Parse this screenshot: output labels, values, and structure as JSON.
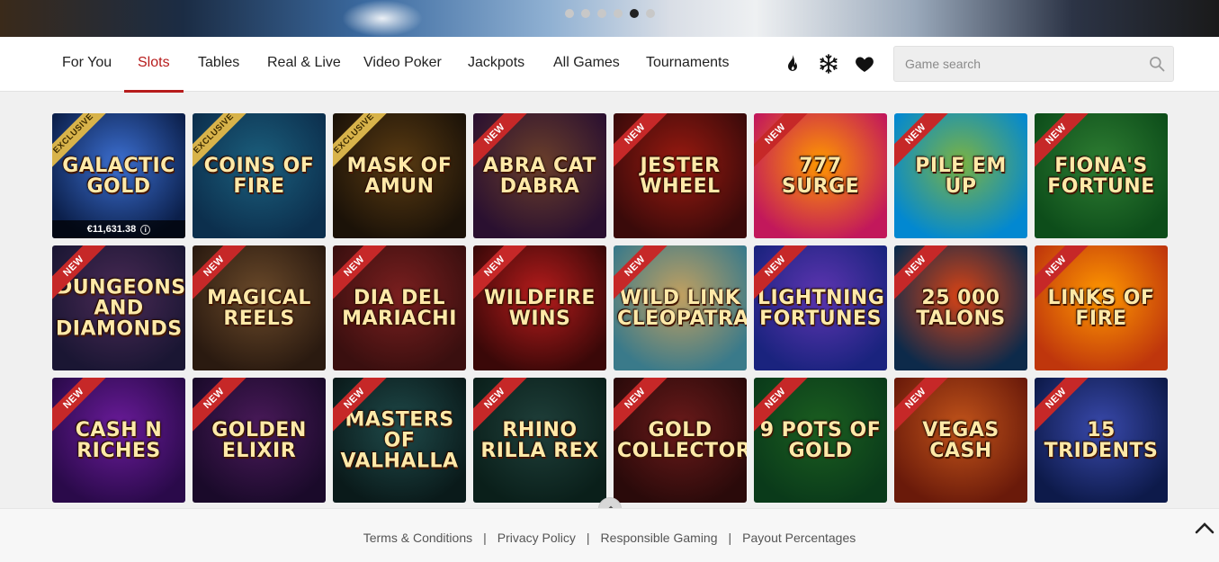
{
  "hero": {
    "slide_count": 6,
    "active_index": 4
  },
  "nav": {
    "tabs": [
      {
        "label": "For You",
        "active": false
      },
      {
        "label": "Slots",
        "active": true
      },
      {
        "label": "Tables",
        "active": false
      },
      {
        "label": "Real & Live",
        "active": false
      },
      {
        "label": "Video Poker",
        "active": false
      },
      {
        "label": "Jackpots",
        "active": false
      },
      {
        "label": "All Games",
        "active": false
      },
      {
        "label": "Tournaments",
        "active": false
      }
    ],
    "icons": [
      "fire-icon",
      "snowflake-icon",
      "heart-icon"
    ],
    "search_placeholder": "Game search"
  },
  "games": [
    {
      "title": "GALACTIC GOLD",
      "badge": "EXCLUSIVE",
      "jackpot": "€11,631.38",
      "colors": [
        "#0b1f4a",
        "#3c6fd1"
      ]
    },
    {
      "title": "COINS OF FIRE",
      "badge": "EXCLUSIVE",
      "colors": [
        "#0c2f4d",
        "#1b5f7d"
      ]
    },
    {
      "title": "MASK OF AMUN",
      "badge": "EXCLUSIVE",
      "colors": [
        "#1b1208",
        "#5a3b12"
      ]
    },
    {
      "title": "ABRA CAT DABRA",
      "badge": "NEW",
      "colors": [
        "#2a1030",
        "#6b3f2a"
      ]
    },
    {
      "title": "JESTER WHEEL",
      "badge": "NEW",
      "colors": [
        "#3a0a0a",
        "#9a1a10"
      ]
    },
    {
      "title": "777 SURGE",
      "badge": "NEW",
      "colors": [
        "#c2185b",
        "#ff9800"
      ]
    },
    {
      "title": "PILE EM UP",
      "badge": "NEW",
      "colors": [
        "#0288d1",
        "#7cb342"
      ]
    },
    {
      "title": "FIONA'S FORTUNE",
      "badge": "NEW",
      "colors": [
        "#0d4d1a",
        "#2e7d32"
      ]
    },
    {
      "title": "DUNGEONS AND DIAMONDS",
      "badge": "NEW",
      "colors": [
        "#1a1633",
        "#4a2a55"
      ]
    },
    {
      "title": "MAGICAL REELS",
      "badge": "NEW",
      "colors": [
        "#2a1a10",
        "#6b4a2a"
      ]
    },
    {
      "title": "DIA DEL MARIACHI",
      "badge": "NEW",
      "colors": [
        "#3a0f0f",
        "#7a1f1f"
      ]
    },
    {
      "title": "WILDFIRE WINS",
      "badge": "NEW",
      "colors": [
        "#3a0808",
        "#b71c1c"
      ]
    },
    {
      "title": "WILD LINK CLEOPATRA",
      "badge": "NEW",
      "colors": [
        "#3a7a8a",
        "#c2a060"
      ]
    },
    {
      "title": "LIGHTNING FORTUNES",
      "badge": "NEW",
      "colors": [
        "#1a237e",
        "#5e35b1"
      ]
    },
    {
      "title": "25 000 TALONS",
      "badge": "NEW",
      "colors": [
        "#0d2a4a",
        "#d84315"
      ]
    },
    {
      "title": "LINKS OF FIRE",
      "badge": "NEW",
      "colors": [
        "#bf360c",
        "#ff9800"
      ]
    },
    {
      "title": "CASH N RICHES",
      "badge": "NEW",
      "colors": [
        "#2a0a4a",
        "#6a1b9a"
      ]
    },
    {
      "title": "GOLDEN ELIXIR",
      "badge": "NEW",
      "colors": [
        "#1a0a2a",
        "#4a1a5a"
      ]
    },
    {
      "title": "MASTERS OF VALHALLA",
      "badge": "NEW",
      "colors": [
        "#0a1a1a",
        "#1f4a4a"
      ]
    },
    {
      "title": "RHINO RILLA REX",
      "badge": "NEW",
      "colors": [
        "#0a1f1a",
        "#1f3f3a"
      ]
    },
    {
      "title": "GOLD COLLECTOR",
      "badge": "NEW",
      "colors": [
        "#2a0a0a",
        "#6a1a1a"
      ]
    },
    {
      "title": "9 POTS OF GOLD",
      "badge": "NEW",
      "colors": [
        "#0a3a1a",
        "#1b5e20"
      ]
    },
    {
      "title": "VEGAS CASH",
      "badge": "NEW",
      "colors": [
        "#6a1a0a",
        "#c2541a"
      ]
    },
    {
      "title": "15 TRIDENTS",
      "badge": "NEW",
      "colors": [
        "#0d1a4a",
        "#3949ab"
      ]
    }
  ],
  "footer": {
    "links": [
      "Terms & Conditions",
      "Privacy Policy",
      "Responsible Gaming",
      "Payout Percentages"
    ],
    "separator": "|"
  }
}
